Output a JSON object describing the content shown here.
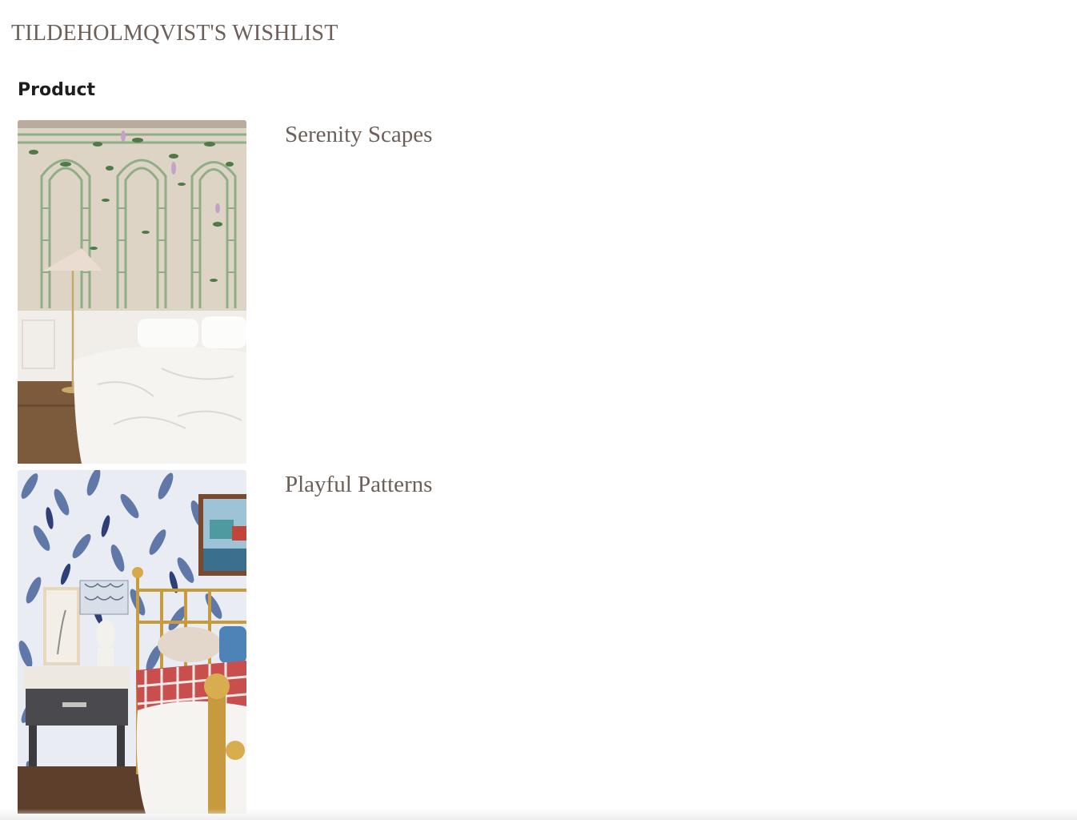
{
  "wishlist": {
    "title": "TILDEHOLMQVIST'S WISHLIST",
    "column_header": "Product"
  },
  "products": [
    {
      "name": "Serenity Scapes",
      "image": "bedroom-trellis-mural-photo"
    },
    {
      "name": "Playful Patterns",
      "image": "bedroom-blue-leaf-wallpaper-photo"
    }
  ],
  "colors": {
    "title_text": "#6b5f58",
    "header_text": "#1e1e22",
    "background": "#ffffff"
  }
}
